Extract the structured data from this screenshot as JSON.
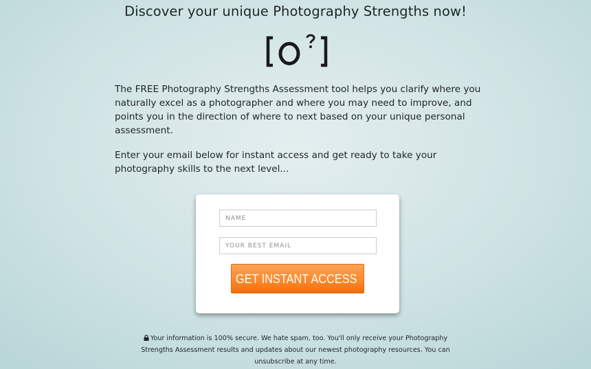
{
  "page": {
    "headline": "Discover your unique Photography Strengths now!",
    "logo": {
      "text": "[O?]",
      "icon": "bracketed-lens-question-logo"
    },
    "intro_paragraph": "The FREE Photography Strengths Assessment tool helps you clarify where you naturally excel as a photographer and where you may need to improve, and points you in the direction of where to next based on your unique personal assessment.",
    "cta_paragraph": "Enter your email below for instant access and get ready to take your photography skills to the next level..."
  },
  "form": {
    "name_placeholder": "NAME",
    "name_value": "",
    "email_placeholder": "YOUR BEST EMAIL",
    "email_value": "",
    "submit_label": "GET INSTANT ACCESS",
    "submit_icon": "lightning-bolt-icon"
  },
  "notice": {
    "icon": "lock-icon",
    "text": "Your information is 100% secure. We hate spam, too. You'll only receive your Photography Strengths Assessment results and updates about our newest photography resources. You can unsubscribe at any time."
  },
  "colors": {
    "background": "#cfe3e4",
    "text": "#1e2426",
    "button_top": "#fca35a",
    "button_bottom": "#f46e0d",
    "field_border": "#c9cccd"
  }
}
